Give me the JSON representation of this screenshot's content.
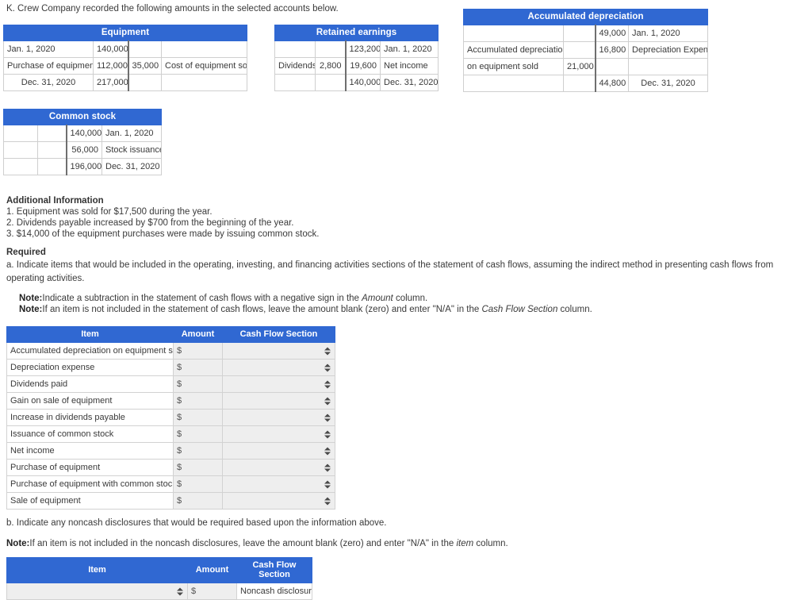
{
  "intro": "K. Crew Company recorded the following amounts in the selected accounts below.",
  "ledgers": {
    "equipment": {
      "title": "Equipment",
      "rows": [
        {
          "c1": "Jan. 1, 2020",
          "c2": "140,000",
          "c3": "",
          "c4": ""
        },
        {
          "c1": "Purchase of equipment",
          "c2": "112,000",
          "c3": "35,000",
          "c4": "Cost of equipment sold"
        },
        {
          "c1": "Dec. 31, 2020",
          "c2": "217,000",
          "c3": "",
          "c4": ""
        }
      ]
    },
    "retained_earnings": {
      "title": "Retained earnings",
      "rows": [
        {
          "c1": "",
          "c2": "",
          "c3": "123,200",
          "c4": "Jan. 1, 2020"
        },
        {
          "c1": "Dividends",
          "c2": "2,800",
          "c3": "19,600",
          "c4": "Net income"
        },
        {
          "c1": "",
          "c2": "",
          "c3": "140,000",
          "c4": "Dec. 31, 2020"
        }
      ]
    },
    "accumulated_depreciation": {
      "title": "Accumulated depreciation",
      "rows": [
        {
          "c1": "",
          "c2": "",
          "c3": "49,000",
          "c4": "Jan. 1, 2020"
        },
        {
          "c1": "Accumulated depreciation",
          "c2": "",
          "c3": "16,800",
          "c4": "Depreciation Expense"
        },
        {
          "c1": "on equipment sold",
          "c2": "21,000",
          "c3": "",
          "c4": ""
        },
        {
          "c1": "",
          "c2": "",
          "c3": "44,800",
          "c4": "Dec. 31, 2020"
        }
      ]
    },
    "common_stock": {
      "title": "Common stock",
      "rows": [
        {
          "c1": "",
          "c2": "",
          "c3": "140,000",
          "c4": "Jan. 1, 2020"
        },
        {
          "c1": "",
          "c2": "",
          "c3": "56,000",
          "c4": "Stock issuance"
        },
        {
          "c1": "",
          "c2": "",
          "c3": "196,000",
          "c4": "Dec. 31, 2020"
        }
      ]
    }
  },
  "additional_information": {
    "heading": "Additional Information",
    "items": [
      "1. Equipment was sold for $17,500 during the year.",
      "2. Dividends payable increased by $700 from the beginning of the year.",
      "3. $14,000 of the equipment purchases were made by issuing common stock."
    ]
  },
  "required": {
    "heading": "Required",
    "part_a": "a. Indicate items that would be included in the operating, investing, and financing activities sections of the statement of cash flows, assuming the indirect method in presenting cash flows from operating activities.",
    "note_a1_label": "Note:",
    "note_a1_pre": "Indicate a subtraction in the statement of cash flows with a negative sign in the ",
    "note_a1_italic": "Amount",
    "note_a1_post": " column.",
    "note_a2_label": "Note:",
    "note_a2_pre": "If an item is not included in the statement of cash flows, leave the amount blank (zero) and enter \"N/A\" in the ",
    "note_a2_italic": "Cash Flow Section",
    "note_a2_post": " column.",
    "part_b": "b. Indicate any noncash disclosures that would be required based upon the information above.",
    "note_b_label": "Note:",
    "note_b_pre": "If an item is not included in the noncash disclosures, leave the amount blank (zero) and enter \"N/A\" in the ",
    "note_b_italic": "item",
    "note_b_post": " column."
  },
  "table_a": {
    "headers": [
      "Item",
      "Amount",
      "Cash Flow Section"
    ],
    "dollar_sign": "$",
    "rows": [
      {
        "item": "Accumulated depreciation on equipment sold",
        "amount": "",
        "section": ""
      },
      {
        "item": "Depreciation expense",
        "amount": "",
        "section": ""
      },
      {
        "item": "Dividends paid",
        "amount": "",
        "section": ""
      },
      {
        "item": "Gain on sale of equipment",
        "amount": "",
        "section": ""
      },
      {
        "item": "Increase in dividends payable",
        "amount": "",
        "section": ""
      },
      {
        "item": "Issuance of common stock",
        "amount": "",
        "section": ""
      },
      {
        "item": "Net income",
        "amount": "",
        "section": ""
      },
      {
        "item": "Purchase of equipment",
        "amount": "",
        "section": ""
      },
      {
        "item": "Purchase of equipment with common stock",
        "amount": "",
        "section": ""
      },
      {
        "item": "Sale of equipment",
        "amount": "",
        "section": ""
      }
    ]
  },
  "table_b": {
    "headers": [
      "Item",
      "Amount",
      "Cash Flow Section"
    ],
    "dollar_sign": "$",
    "rows": [
      {
        "item": "",
        "amount": "",
        "section": "Noncash disclosure"
      }
    ]
  },
  "colors": {
    "header_blue": "#3068d2",
    "input_gray": "#eeeeee",
    "border_gray": "#cfcfcf",
    "text": "#3a3a3a"
  }
}
